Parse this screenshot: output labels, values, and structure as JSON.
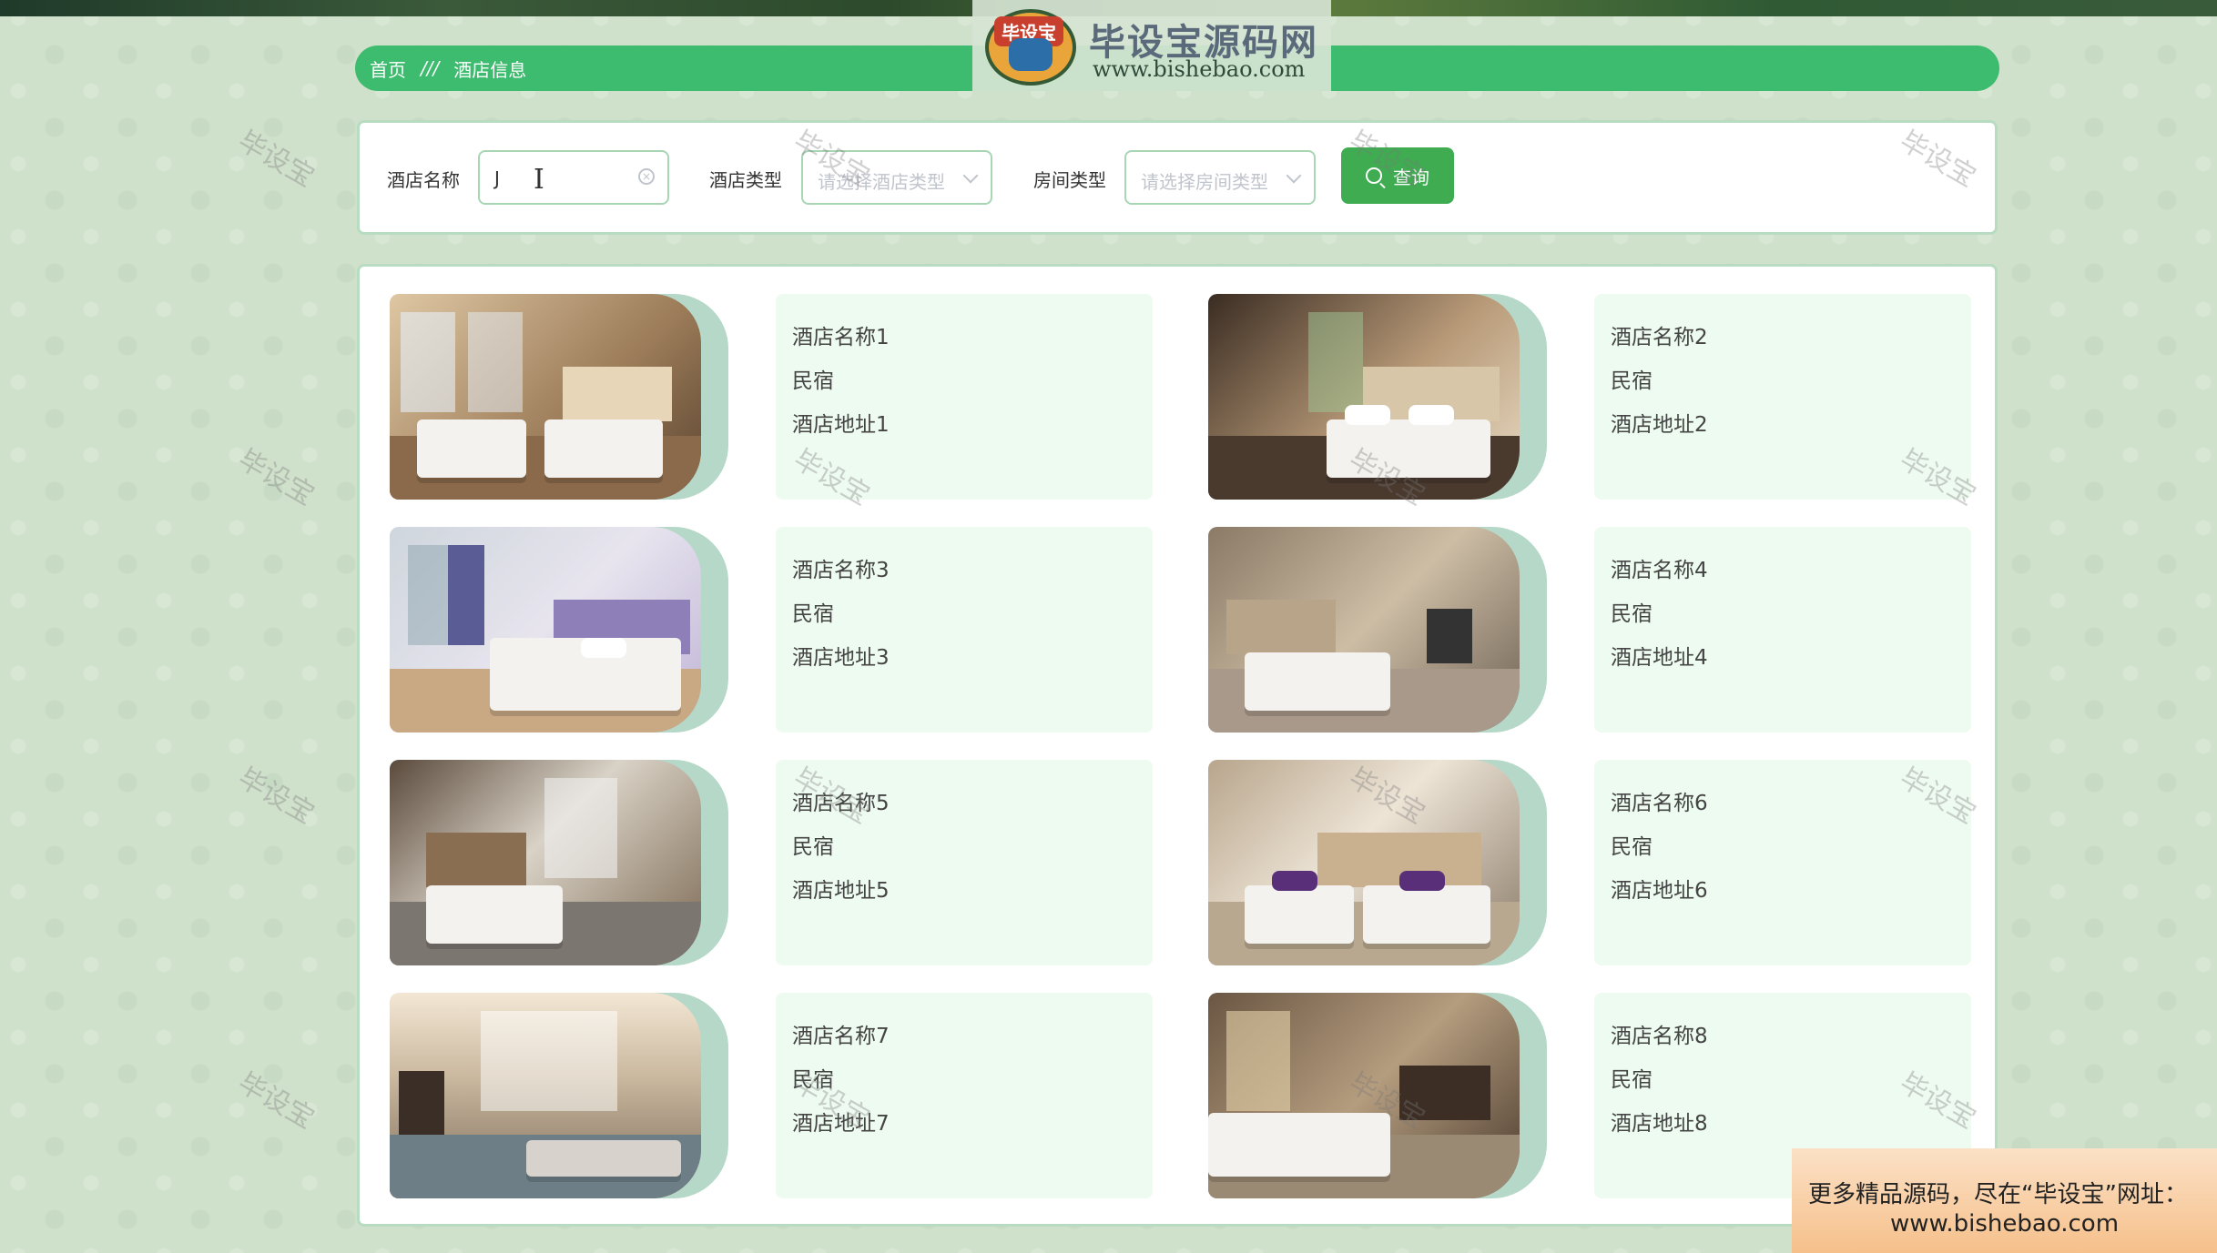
{
  "logo": {
    "badge_text": "毕设宝",
    "title": "毕设宝源码网",
    "url": "www.bishebao.com"
  },
  "breadcrumb": {
    "home": "首页",
    "separator": "///",
    "current": "酒店信息"
  },
  "search": {
    "name_label": "酒店名称",
    "name_value": "J",
    "type_label": "酒店类型",
    "type_placeholder": "请选择酒店类型",
    "room_label": "房间类型",
    "room_placeholder": "请选择房间类型",
    "query_button": "查询"
  },
  "hotels": [
    {
      "name": "酒店名称1",
      "type": "民宿",
      "address": "酒店地址1"
    },
    {
      "name": "酒店名称2",
      "type": "民宿",
      "address": "酒店地址2"
    },
    {
      "name": "酒店名称3",
      "type": "民宿",
      "address": "酒店地址3"
    },
    {
      "name": "酒店名称4",
      "type": "民宿",
      "address": "酒店地址4"
    },
    {
      "name": "酒店名称5",
      "type": "民宿",
      "address": "酒店地址5"
    },
    {
      "name": "酒店名称6",
      "type": "民宿",
      "address": "酒店地址6"
    },
    {
      "name": "酒店名称7",
      "type": "民宿",
      "address": "酒店地址7"
    },
    {
      "name": "酒店名称8",
      "type": "民宿",
      "address": "酒店地址8"
    }
  ],
  "watermark": "毕设宝",
  "promo": {
    "line1": "更多精品源码，尽在“毕设宝”网址：",
    "line2": "www.bishebao.com"
  },
  "colors": {
    "accent": "#3dbb6e",
    "button": "#3fac52",
    "card_bg": "#eefbf0",
    "page_bg": "#cfe0cb"
  }
}
